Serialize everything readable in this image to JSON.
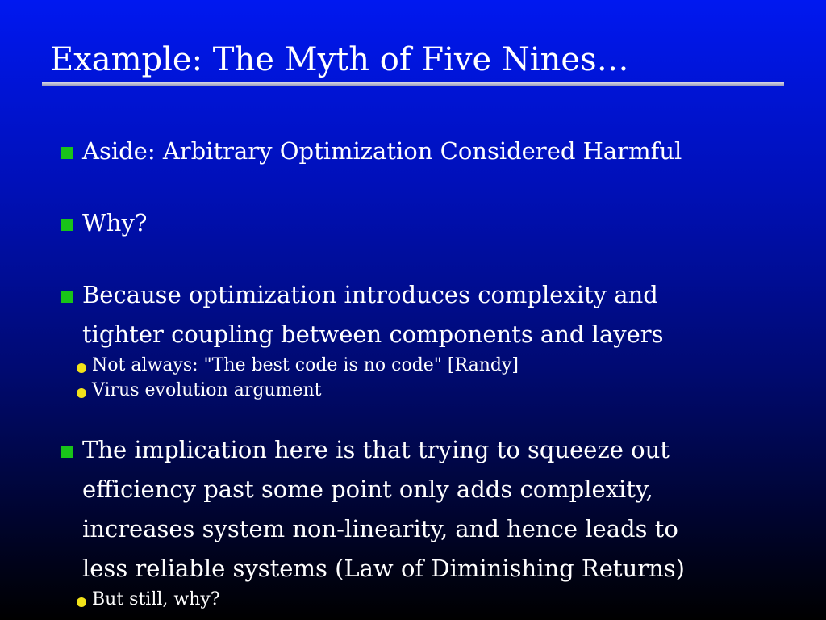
{
  "slide": {
    "title": "Example: The Myth of Five Nines…",
    "bullets": [
      {
        "lines": [
          "Aside: Arbitrary Optimization Considered Harmful"
        ]
      },
      {
        "lines": [
          "Why?"
        ]
      },
      {
        "lines": [
          "Because optimization introduces complexity and",
          "tighter coupling between components and layers"
        ],
        "subbullets": [
          "Not always: \"The best code is no code\" [Randy]",
          "Virus evolution argument"
        ]
      },
      {
        "lines": [
          "The implication here is that trying to squeeze out",
          "efficiency past some point only adds complexity,",
          "increases system non-linearity, and hence leads to",
          "less reliable systems (Law of Diminishing Returns)"
        ],
        "subbullets": [
          "But still, why?"
        ]
      }
    ]
  },
  "colors": {
    "background_top": "#0018f0",
    "background_bottom": "#000000",
    "bullet_square": "#19c419",
    "subbullet_dot": "#f2e21a",
    "text": "#ffffff"
  }
}
